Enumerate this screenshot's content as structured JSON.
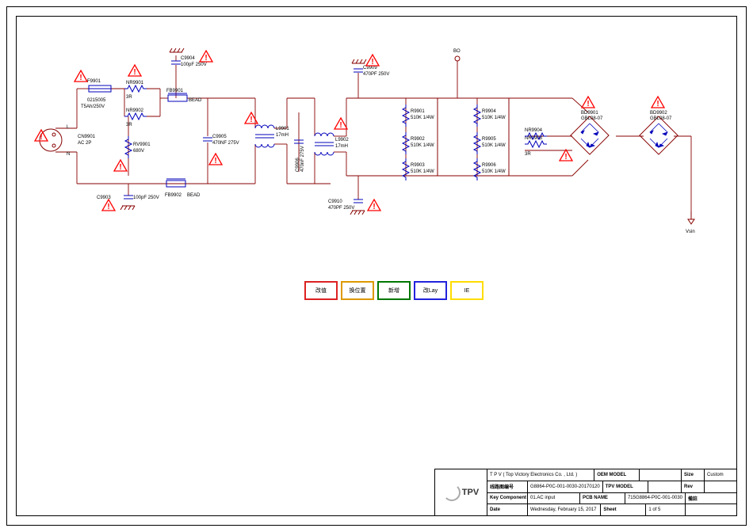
{
  "legend": {
    "items": [
      {
        "label": "改值",
        "color": "#d22"
      },
      {
        "label": "换位置",
        "color": "#d90"
      },
      {
        "label": "新增",
        "color": "#070"
      },
      {
        "label": "改Lay",
        "color": "#22d"
      },
      {
        "label": "IE",
        "color": "#fd0"
      }
    ]
  },
  "title_block": {
    "company": "T P V  ( Top  Victory  Electronics  Co. ,  Ltd. )",
    "row1_label": "线路图编号",
    "row1_value": "G8864-P0C-001-0030-20170120",
    "oem_model_label": "OEM MODEL",
    "oem_model_value": "",
    "tpv_model_label": "TPV MODEL",
    "tpv_model_value": "",
    "size_label": "Size",
    "size_value": "Custom",
    "rev_label": "Rev",
    "rev_value": "",
    "key_label": "Key Component",
    "key_value": "01.AC input",
    "pcb_label": "PCB NAME",
    "pcb_value": "715G8864-P0C-001-0030",
    "date_label": "Date",
    "date_value": "Wednesday, February 15, 2017",
    "sheet_label": "Sheet",
    "sheet_value": "1  of  5",
    "note_label": "備註"
  },
  "nodes": {
    "bo": "BO",
    "vsin": "Vsin",
    "L": "L",
    "N": "N"
  },
  "components": {
    "cn9901": {
      "ref": "CN9901",
      "val": "AC 2P"
    },
    "f9901": {
      "ref": "F9901",
      "val": "0215005"
    },
    "f9901_rating": "T5Ah/250V",
    "nr9901": {
      "ref": "NR9901",
      "val": "3R"
    },
    "nr9902": {
      "ref": "NR9902",
      "val": "3R"
    },
    "nr9903": {
      "ref": "NR9903",
      "val": "3R"
    },
    "nr9904": {
      "ref": "NR9904"
    },
    "fb9901": {
      "ref": "FB9901",
      "val": "BEAD"
    },
    "fb9902": {
      "ref": "FB9902",
      "val": "BEAD"
    },
    "rv9901": {
      "ref": "RV9901",
      "val": "680V"
    },
    "c9903": {
      "ref": "C9903",
      "val": "100pF 250V"
    },
    "c9904": {
      "ref": "C9904",
      "val": "100pF 250V"
    },
    "c9905": {
      "ref": "C9905",
      "val": "470NF 275V"
    },
    "c9906": {
      "ref": "C9906",
      "val": "470nF 275V"
    },
    "c9909": {
      "ref": "C9909",
      "val": "470PF 250V"
    },
    "c9910": {
      "ref": "C9910",
      "val": "470PF 250V"
    },
    "l9901": {
      "ref": "L9901",
      "val": "17mH"
    },
    "l9902": {
      "ref": "L9902",
      "val": "17mH"
    },
    "r9901": {
      "ref": "R9901",
      "val": "510K 1/4W"
    },
    "r9902": {
      "ref": "R9902",
      "val": "510K 1/4W"
    },
    "r9903": {
      "ref": "R9903",
      "val": "510K 1/4W"
    },
    "r9904": {
      "ref": "R9904",
      "val": "510K 1/4W"
    },
    "r9905": {
      "ref": "R9905",
      "val": "510K 1/4W"
    },
    "r9906": {
      "ref": "R9906",
      "val": "510K 1/4W"
    },
    "bd9901": {
      "ref": "BD9901",
      "val": "GBL08-07"
    },
    "bd9902": {
      "ref": "BD9902",
      "val": "GBL08-07"
    }
  }
}
